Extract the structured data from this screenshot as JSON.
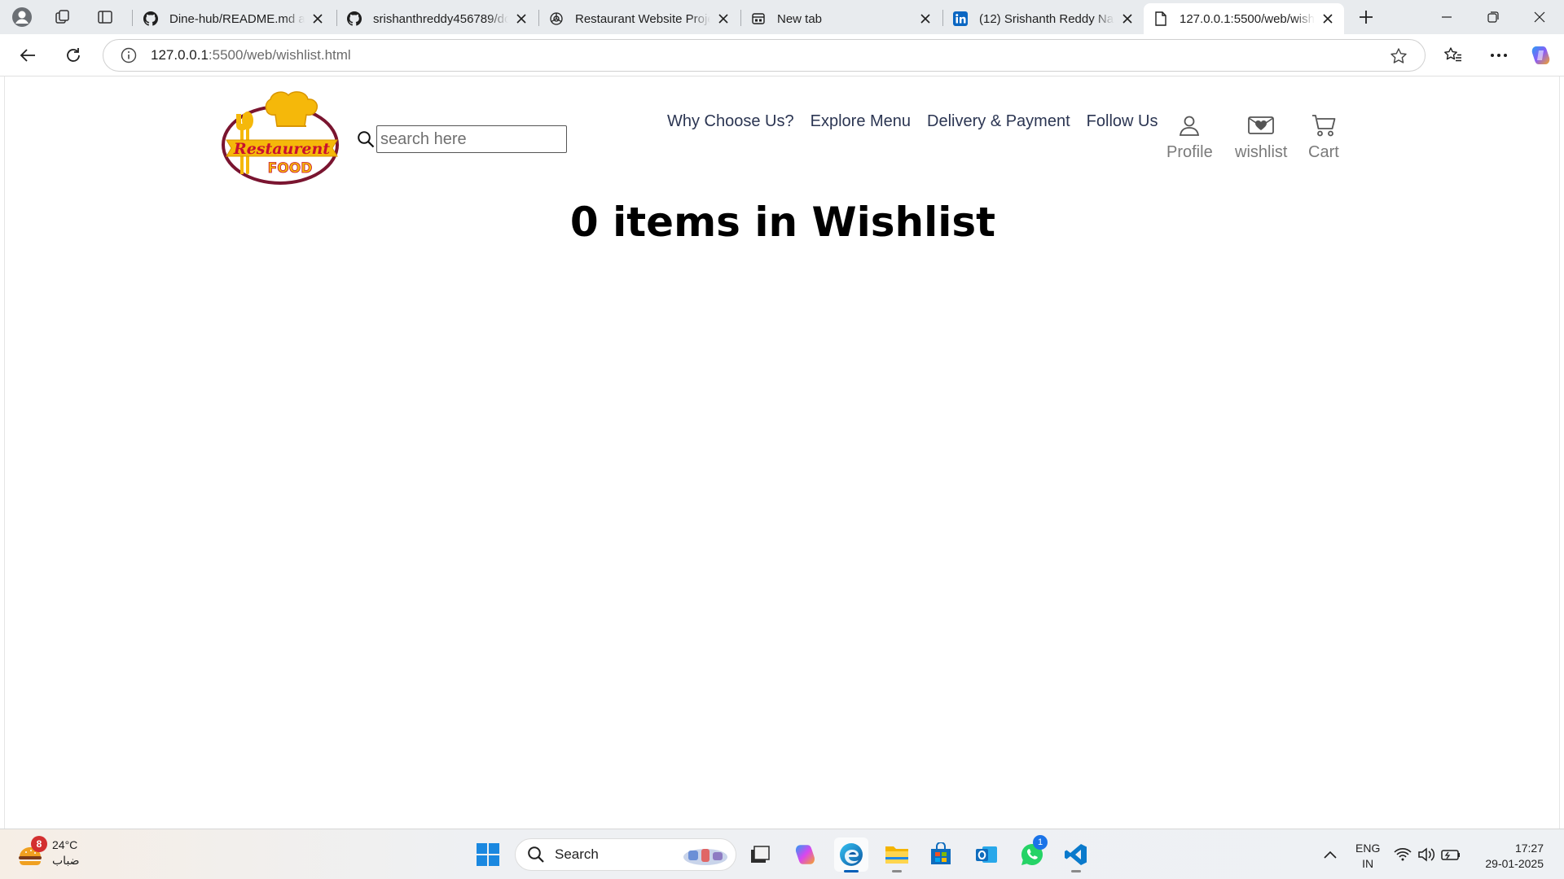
{
  "browser": {
    "tabs": [
      {
        "title": "Dine-hub/README.md at",
        "favicon": "github-icon",
        "active": false
      },
      {
        "title": "srishanthreddy456789/do",
        "favicon": "github-icon",
        "active": false
      },
      {
        "title": "Restaurant Website Projec",
        "favicon": "chatgpt-icon",
        "active": false
      },
      {
        "title": "New tab",
        "favicon": "new-tab-page-icon",
        "active": false
      },
      {
        "title": "(12) Srishanth Reddy Narr",
        "favicon": "linkedin-icon",
        "active": false
      },
      {
        "title": "127.0.0.1:5500/web/wishli",
        "favicon": "page-icon",
        "active": true
      }
    ],
    "address": {
      "host": "127.0.0.1",
      "path": ":5500/web/wishlist.html"
    }
  },
  "site": {
    "logo": {
      "line1": "Restaurent",
      "line2": "FOOD"
    },
    "search": {
      "placeholder": "search here"
    },
    "nav": {
      "links": [
        "Why Choose Us?",
        "Explore Menu",
        "Delivery & Payment",
        "Follow Us"
      ],
      "profile_label": "Profile",
      "wishlist_label": "wishlist",
      "cart_label": "Cart"
    },
    "heading": "0 items in Wishlist"
  },
  "taskbar": {
    "weather": {
      "temp": "24°C",
      "condition": "ضباب",
      "badge": "8"
    },
    "search_label": "Search",
    "whatsapp_badge": "1",
    "language": {
      "line1": "ENG",
      "line2": "IN"
    },
    "clock": {
      "time": "17:27",
      "date": "29-01-2025"
    }
  },
  "colors": {
    "tabstrip_bg": "#e8ebee",
    "nav_text": "#2b3552",
    "logo_red": "#c8102e",
    "logo_gold": "#f5b80a",
    "logo_maroon": "#7a1530"
  }
}
